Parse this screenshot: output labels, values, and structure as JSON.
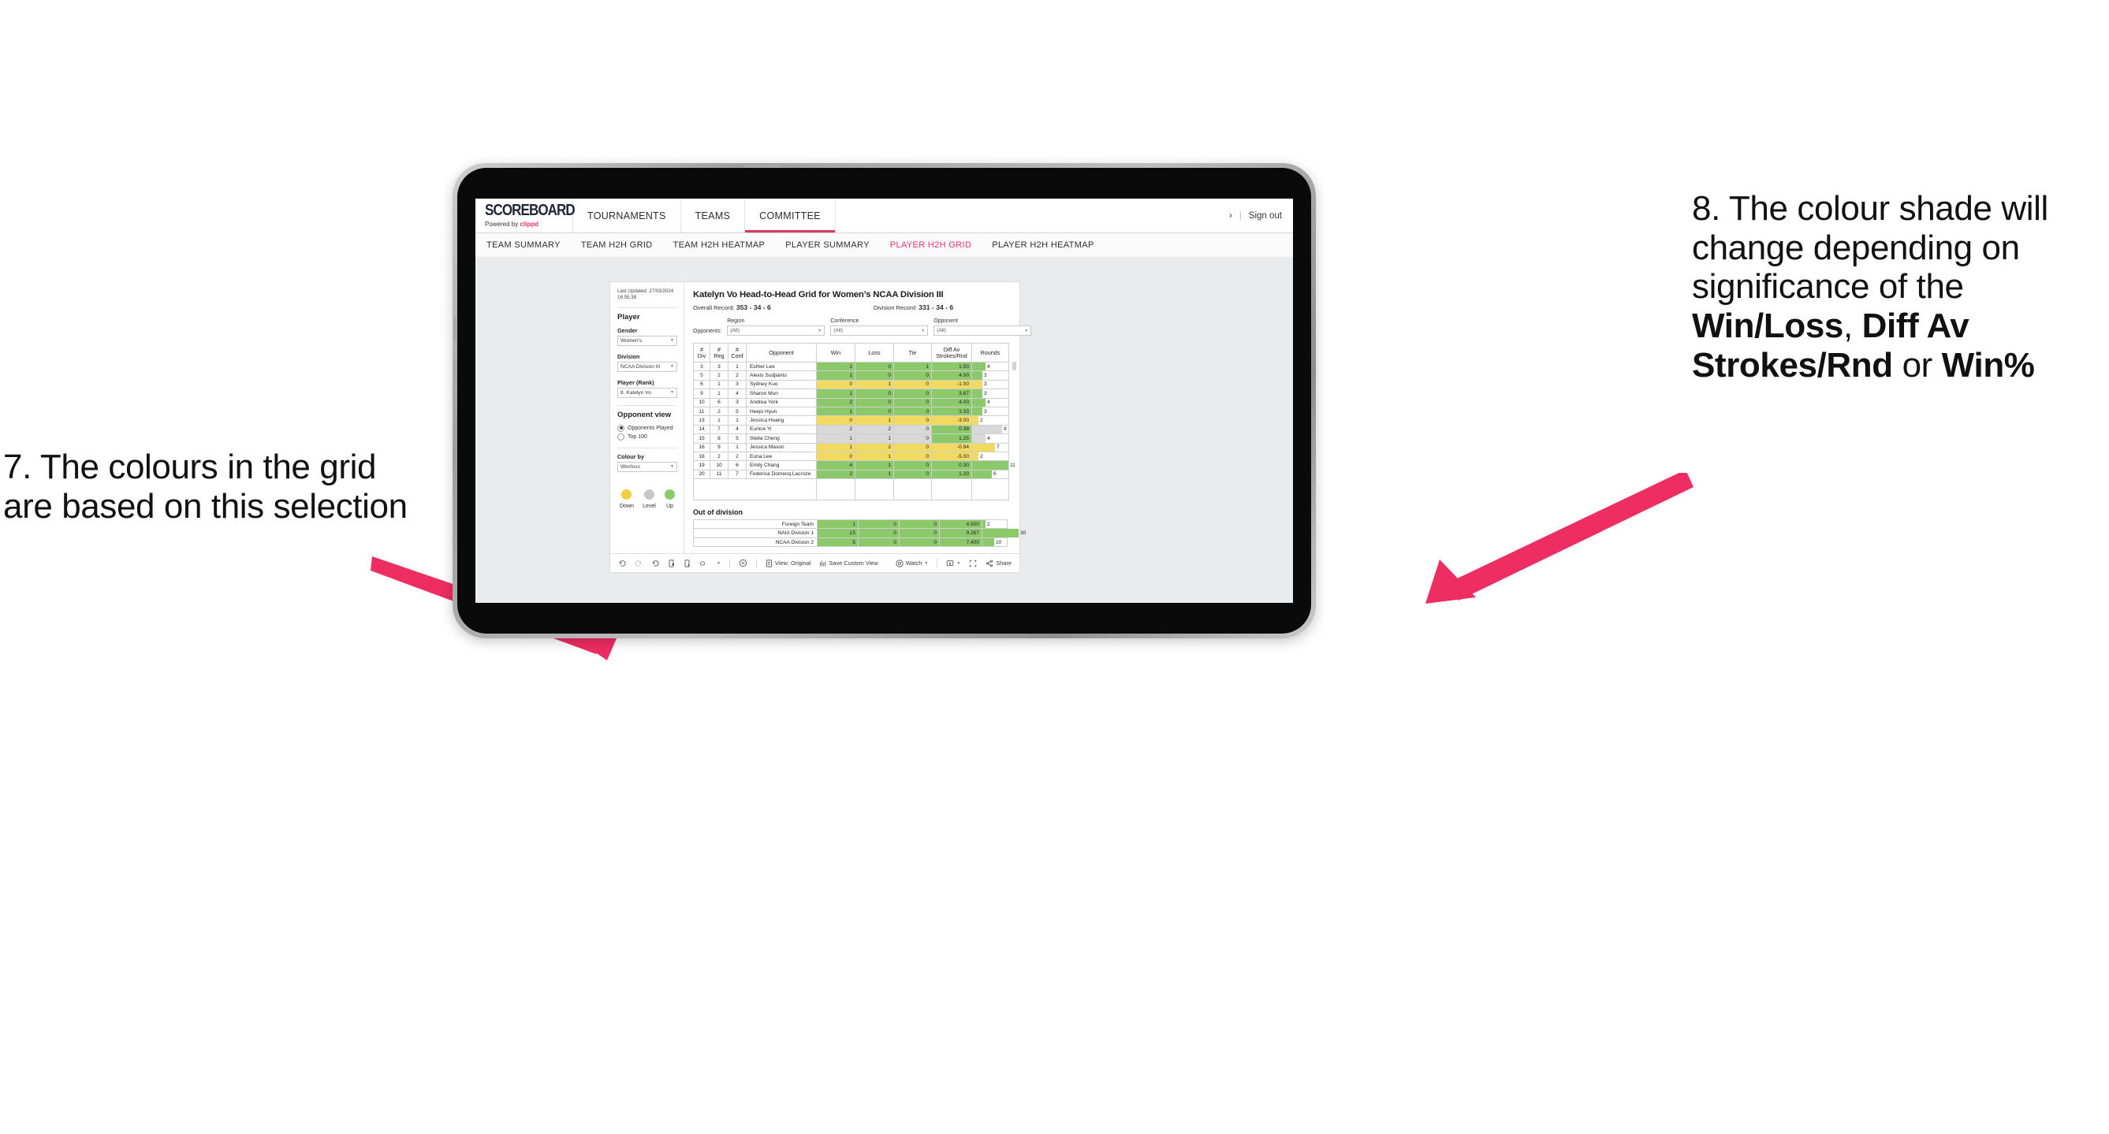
{
  "annotations": {
    "left": {
      "id": "annotation-7",
      "text": "7. The colours in the grid are based on this selection"
    },
    "right": {
      "id": "annotation-8",
      "lead": "8. The colour shade will change depending on significance of the ",
      "bold1": "Win/Loss",
      "mid1": ", ",
      "bold2": "Diff Av Strokes/Rnd",
      "mid2": " or ",
      "bold3": "Win%"
    },
    "arrow_color": "#ee2d62"
  },
  "app": {
    "brand": {
      "name": "SCOREBOARD",
      "powered_prefix": "Powered by ",
      "powered_brand": "clippd"
    },
    "nav": [
      {
        "label": "TOURNAMENTS",
        "active": false
      },
      {
        "label": "TEAMS",
        "active": false
      },
      {
        "label": "COMMITTEE",
        "active": true
      }
    ],
    "account": {
      "chevron": "›",
      "divider": "|",
      "sign_out": "Sign out"
    },
    "subnav": [
      {
        "label": "TEAM SUMMARY",
        "active": false
      },
      {
        "label": "TEAM H2H GRID",
        "active": false
      },
      {
        "label": "TEAM H2H HEATMAP",
        "active": false
      },
      {
        "label": "PLAYER SUMMARY",
        "active": false
      },
      {
        "label": "PLAYER H2H GRID",
        "active": true
      },
      {
        "label": "PLAYER H2H HEATMAP",
        "active": false
      }
    ]
  },
  "sidebar": {
    "last_updated_label": "Last Updated: 27/03/2024",
    "last_updated_time": "16:55:38",
    "player_heading": "Player",
    "gender_label": "Gender",
    "gender_value": "Women’s",
    "division_label": "Division",
    "division_value": "NCAA Division III",
    "player_rank_label": "Player (Rank)",
    "player_rank_value": "8. Katelyn Vo",
    "opponent_view_heading": "Opponent view",
    "opponent_options": [
      {
        "label": "Opponents Played",
        "selected": true
      },
      {
        "label": "Top 100",
        "selected": false
      }
    ],
    "colour_by_label": "Colour by",
    "colour_by_value": "Win/loss",
    "legend": [
      {
        "label": "Down",
        "color": "#f2cf3f"
      },
      {
        "label": "Level",
        "color": "#c4c8cb"
      },
      {
        "label": "Up",
        "color": "#8cc96a"
      }
    ]
  },
  "viz": {
    "title": "Katelyn Vo Head-to-Head Grid for Women’s NCAA Division III",
    "overall_record_label": "Overall Record: ",
    "overall_record_value": "353 -  34 - 6",
    "division_record_label": "Division Record: ",
    "division_record_value": "331 -  34 - 6",
    "opponents_label": "Opponents:",
    "filters": [
      {
        "caption": "Region",
        "value": "(All)"
      },
      {
        "caption": "Conference",
        "value": "(All)"
      },
      {
        "caption": "Opponent",
        "value": "(All)"
      }
    ],
    "columns": [
      "#\nDiv",
      "#\nReg",
      "#\nConf",
      "Opponent",
      "Win",
      "Loss",
      "Tie",
      "Diff Av\nStrokes/Rnd",
      "Rounds"
    ],
    "out_of_division_title": "Out of division"
  },
  "chart_data": {
    "type": "table",
    "title": "Katelyn Vo Head-to-Head Grid for Women’s NCAA Division III",
    "colors": {
      "up": "#8cc96a",
      "down": "#f2da60",
      "level": "#d8d8d8",
      "blank": "#ffffff"
    },
    "columns": [
      "#Div",
      "#Reg",
      "#Conf",
      "Opponent",
      "Win",
      "Loss",
      "Tie",
      "Diff Av Strokes/Rnd",
      "Rounds"
    ],
    "max_rounds": 11,
    "rows": [
      {
        "div": "3",
        "reg": "3",
        "conf": "1",
        "opponent": "Esther Lee",
        "win": "1",
        "loss": "0",
        "tie": "1",
        "diff": "1.50",
        "rounds": 4,
        "state": "up"
      },
      {
        "div": "5",
        "reg": "2",
        "conf": "2",
        "opponent": "Alexis Sudjianto",
        "win": "1",
        "loss": "0",
        "tie": "0",
        "diff": "4.00",
        "rounds": 3,
        "state": "up"
      },
      {
        "div": "6",
        "reg": "1",
        "conf": "3",
        "opponent": "Sydney Kuo",
        "win": "0",
        "loss": "1",
        "tie": "0",
        "diff": "-1.00",
        "rounds": 3,
        "state": "down"
      },
      {
        "div": "9",
        "reg": "1",
        "conf": "4",
        "opponent": "Sharon Mun",
        "win": "1",
        "loss": "0",
        "tie": "0",
        "diff": "3.67",
        "rounds": 3,
        "state": "up"
      },
      {
        "div": "10",
        "reg": "6",
        "conf": "3",
        "opponent": "Andrea York",
        "win": "2",
        "loss": "0",
        "tie": "0",
        "diff": "4.00",
        "rounds": 4,
        "state": "up"
      },
      {
        "div": "11",
        "reg": "2",
        "conf": "5",
        "opponent": "Heejo Hyun",
        "win": "1",
        "loss": "0",
        "tie": "0",
        "diff": "3.33",
        "rounds": 3,
        "state": "up"
      },
      {
        "div": "13",
        "reg": "1",
        "conf": "1",
        "opponent": "Jessica Huang",
        "win": "0",
        "loss": "1",
        "tie": "0",
        "diff": "-3.00",
        "rounds": 2,
        "state": "down"
      },
      {
        "div": "14",
        "reg": "7",
        "conf": "4",
        "opponent": "Eunice Yi",
        "win": "2",
        "loss": "2",
        "tie": "0",
        "diff": "0.38",
        "rounds": 9,
        "state": "level",
        "diff_state": "up"
      },
      {
        "div": "15",
        "reg": "8",
        "conf": "5",
        "opponent": "Stella Cheng",
        "win": "1",
        "loss": "1",
        "tie": "0",
        "diff": "1.25",
        "rounds": 4,
        "state": "level",
        "diff_state": "up"
      },
      {
        "div": "16",
        "reg": "9",
        "conf": "1",
        "opponent": "Jessica Mason",
        "win": "1",
        "loss": "2",
        "tie": "0",
        "diff": "-0.94",
        "rounds": 7,
        "state": "down"
      },
      {
        "div": "18",
        "reg": "2",
        "conf": "2",
        "opponent": "Euna Lee",
        "win": "0",
        "loss": "1",
        "tie": "0",
        "diff": "-5.00",
        "rounds": 2,
        "state": "down"
      },
      {
        "div": "19",
        "reg": "10",
        "conf": "6",
        "opponent": "Emily Chang",
        "win": "4",
        "loss": "1",
        "tie": "0",
        "diff": "0.30",
        "rounds": 11,
        "state": "up"
      },
      {
        "div": "20",
        "reg": "11",
        "conf": "7",
        "opponent": "Federica Domecq Lacroze",
        "win": "2",
        "loss": "1",
        "tie": "0",
        "diff": "1.33",
        "rounds": 6,
        "state": "up"
      }
    ],
    "out_of_division": [
      {
        "name": "Foreign Team",
        "win": "1",
        "loss": "0",
        "tie": "0",
        "diff": "4.500",
        "rounds": 2,
        "state": "up"
      },
      {
        "name": "NAIA Division 1",
        "win": "15",
        "loss": "0",
        "tie": "0",
        "diff": "9.267",
        "rounds": 30,
        "state": "up"
      },
      {
        "name": "NCAA Division 2",
        "win": "5",
        "loss": "0",
        "tie": "0",
        "diff": "7.400",
        "rounds": 10,
        "state": "up"
      }
    ],
    "out_of_division_max_rounds": 30
  },
  "toolbar": {
    "view_label": "View: Original",
    "save_label": "Save Custom View",
    "watch_label": "Watch",
    "share_label": "Share"
  }
}
